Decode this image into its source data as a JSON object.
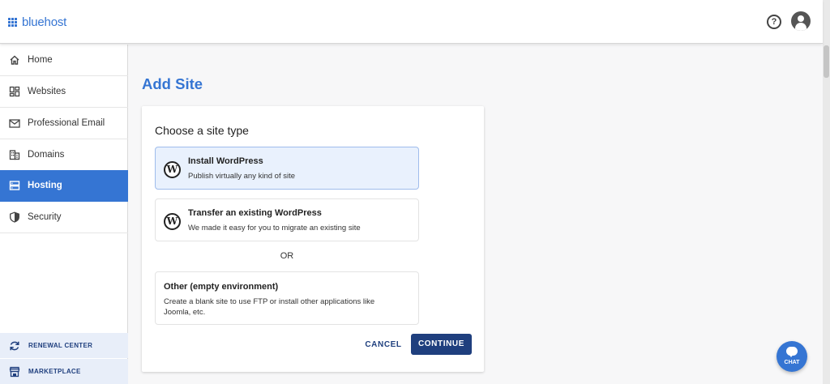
{
  "header": {
    "logo_text": "bluehost"
  },
  "sidebar": {
    "items": [
      {
        "label": "Home",
        "icon": "home-icon"
      },
      {
        "label": "Websites",
        "icon": "dashboard-icon"
      },
      {
        "label": "Professional Email",
        "icon": "mail-icon"
      },
      {
        "label": "Domains",
        "icon": "building-icon"
      },
      {
        "label": "Hosting",
        "icon": "server-icon",
        "active": true
      },
      {
        "label": "Security",
        "icon": "shield-icon"
      }
    ],
    "bottom_items": [
      {
        "label": "RENEWAL CENTER",
        "icon": "refresh-icon"
      },
      {
        "label": "MARKETPLACE",
        "icon": "store-icon"
      }
    ]
  },
  "main": {
    "title": "Add Site",
    "card": {
      "heading": "Choose a site type",
      "options": [
        {
          "title": "Install WordPress",
          "description": "Publish virtually any kind of site",
          "selected": true
        },
        {
          "title": "Transfer an existing WordPress",
          "description": "We made it easy for you to migrate an existing site",
          "selected": false
        }
      ],
      "or_text": "OR",
      "other": {
        "title": "Other (empty environment)",
        "description": "Create a blank site to use FTP or install other applications like Joomla, etc."
      },
      "cancel_label": "CANCEL",
      "continue_label": "CONTINUE"
    }
  },
  "chat": {
    "label": "CHAT"
  },
  "colors": {
    "accent": "#3575d3",
    "primary_dark": "#1f3f7e",
    "selected_bg": "#e9f1fd"
  }
}
